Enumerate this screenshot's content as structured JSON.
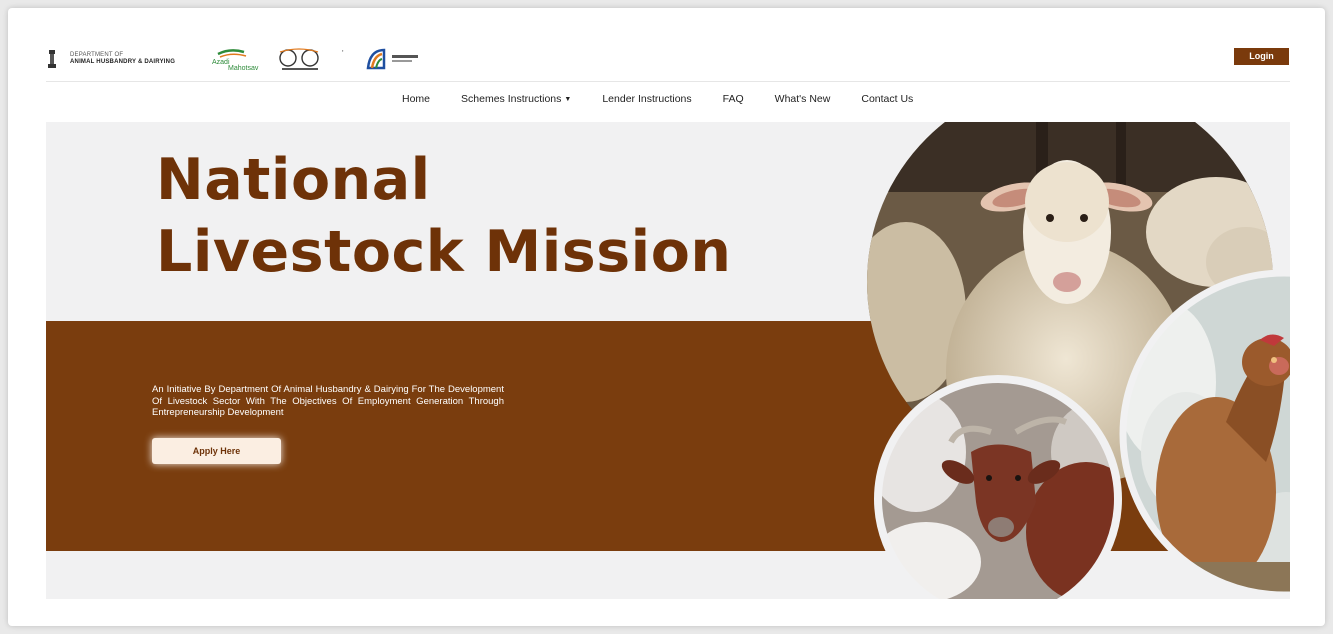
{
  "header": {
    "dept_line1": "DEPARTMENT OF",
    "dept_line2": "ANIMAL HUSBANDRY & DAIRYING",
    "logo_azadi": "Azadi Ka Amrit Mahotsav",
    "logo_g20": "G20 logo",
    "logo_digital": "Digital India",
    "login_label": "Login"
  },
  "nav": {
    "items": [
      {
        "label": "Home"
      },
      {
        "label": "Schemes Instructions"
      },
      {
        "label": "Lender Instructions"
      },
      {
        "label": "FAQ"
      },
      {
        "label": "What's New"
      },
      {
        "label": "Contact Us"
      }
    ]
  },
  "hero": {
    "title_line1": "National",
    "title_line2": "Livestock Mission",
    "description": "An Initiative By Department Of Animal Husbandry & Dairying For The Development Of Livestock Sector With The Objectives Of Employment Generation Through Entrepreneurship Development",
    "apply_label": "Apply Here"
  },
  "colors": {
    "brand_brown": "#7a3d0e",
    "title_brown": "#6e3208",
    "hero_bg": "#f1f1f2",
    "apply_bg": "#fbeee2"
  },
  "images": {
    "sheep": "sheep-photo",
    "goat": "goat-photo",
    "hen": "hen-photo"
  }
}
